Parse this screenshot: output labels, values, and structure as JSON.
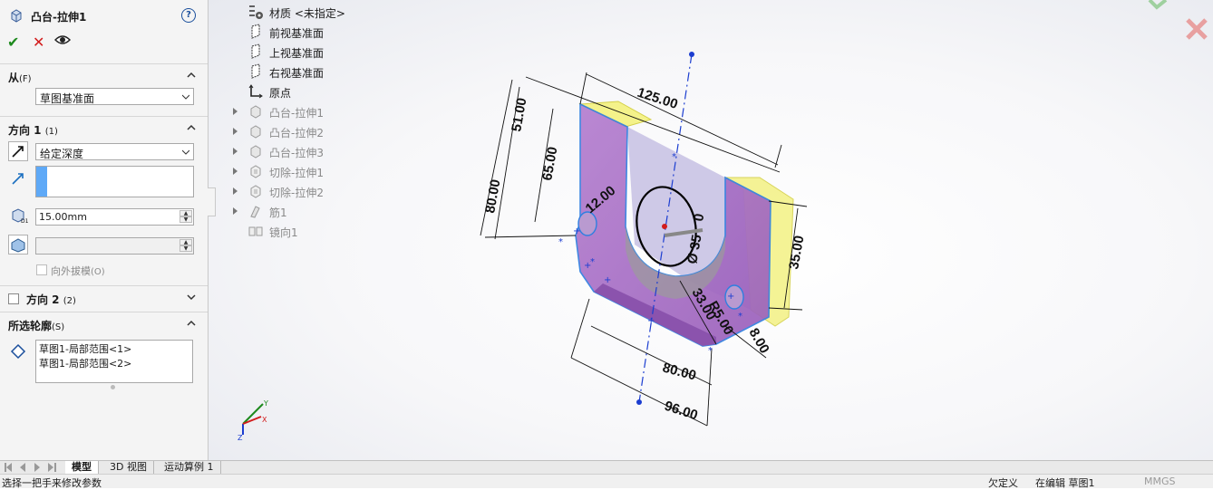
{
  "property_manager": {
    "title": "凸台-拉伸1",
    "help": "?",
    "actions": {
      "ok": "✔",
      "cancel": "✕",
      "preview": "👁"
    },
    "from": {
      "label": "从",
      "shortcut": "(F)",
      "value": "草图基准面"
    },
    "direction1": {
      "label": "方向 1",
      "shortcut": "(1)",
      "end_condition": "给定深度",
      "depth": "15.00mm",
      "draft_outward": "向外拔模",
      "draft_shortcut": "(O)"
    },
    "direction2": {
      "label": "方向 2",
      "shortcut": "(2)"
    },
    "selected_contours": {
      "label": "所选轮廓",
      "shortcut": "(S)",
      "items": [
        "草图1-局部范围<1>",
        "草图1-局部范围<2>"
      ]
    }
  },
  "feature_tree": [
    {
      "label": "材质 <未指定>",
      "icon": "material-icon",
      "expandable": false,
      "dim": false
    },
    {
      "label": "前视基准面",
      "icon": "plane-icon",
      "expandable": false,
      "dim": false
    },
    {
      "label": "上视基准面",
      "icon": "plane-icon",
      "expandable": false,
      "dim": false
    },
    {
      "label": "右视基准面",
      "icon": "plane-icon",
      "expandable": false,
      "dim": false
    },
    {
      "label": "原点",
      "icon": "origin-icon",
      "expandable": false,
      "dim": false
    },
    {
      "label": "凸台-拉伸1",
      "icon": "boss-extrude-icon",
      "expandable": true,
      "dim": true
    },
    {
      "label": "凸台-拉伸2",
      "icon": "boss-extrude-icon",
      "expandable": true,
      "dim": true
    },
    {
      "label": "凸台-拉伸3",
      "icon": "boss-extrude-icon",
      "expandable": true,
      "dim": true
    },
    {
      "label": "切除-拉伸1",
      "icon": "cut-extrude-icon",
      "expandable": true,
      "dim": true
    },
    {
      "label": "切除-拉伸2",
      "icon": "cut-extrude-icon",
      "expandable": true,
      "dim": true
    },
    {
      "label": "筋1",
      "icon": "rib-icon",
      "expandable": true,
      "dim": true
    },
    {
      "label": "镜向1",
      "icon": "mirror-icon",
      "expandable": false,
      "dim": true
    }
  ],
  "dimensions": {
    "d125": "125.00",
    "d51": "51.00",
    "d65": "65.00",
    "d80v": "80.00",
    "d12": "12.00",
    "d35": "35.00",
    "d80h": "80.00",
    "d96": "96.00",
    "d33": "33.00",
    "r5": "R5.00",
    "d8": "8.00",
    "dia": "Ø 35",
    "d0": "0"
  },
  "triad": {
    "x": "X",
    "y": "Y",
    "z": "Z"
  },
  "bottom_tabs": [
    "模型",
    "3D 视图",
    "运动算例 1"
  ],
  "status": {
    "message": "选择一把手来修改参数",
    "state": "欠定义",
    "editing": "在编辑 草图1",
    "units": "MMGS"
  },
  "colors": {
    "part_face": "#a970c7",
    "part_face_light": "#c9a2dc",
    "highlight_yellow": "#f4f28a",
    "edge_blue": "#2f7fe0",
    "dimension": "#111111",
    "accept": "#1e8a1e",
    "reject": "#d21c1c"
  }
}
